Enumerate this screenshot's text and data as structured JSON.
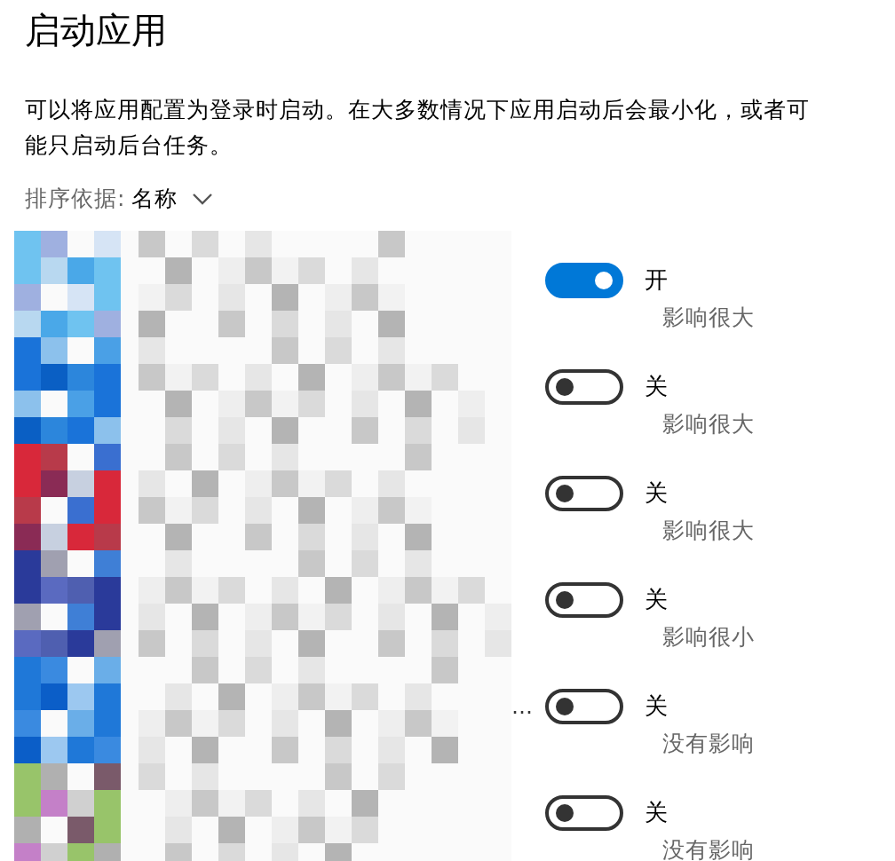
{
  "title": "启动应用",
  "description": "可以将应用配置为登录时启动。在大多数情况下应用启动后会最小化，或者可能只启动后台任务。",
  "sort": {
    "label": "排序依据:",
    "value": "名称"
  },
  "apps": [
    {
      "kind": "picture",
      "on": true,
      "state": "开",
      "impact": "影响很大"
    },
    {
      "kind": "picture",
      "on": false,
      "state": "关",
      "impact": "影响很大"
    },
    {
      "kind": "picture",
      "on": false,
      "state": "关",
      "impact": "影响很大"
    },
    {
      "kind": "picture",
      "on": false,
      "state": "关",
      "impact": "影响很小"
    },
    {
      "kind": "picture",
      "name_end": "…",
      "on": false,
      "state": "关",
      "impact": "没有影响"
    },
    {
      "kind": "picture",
      "on": false,
      "state": "关",
      "impact": "没有影响"
    }
  ]
}
